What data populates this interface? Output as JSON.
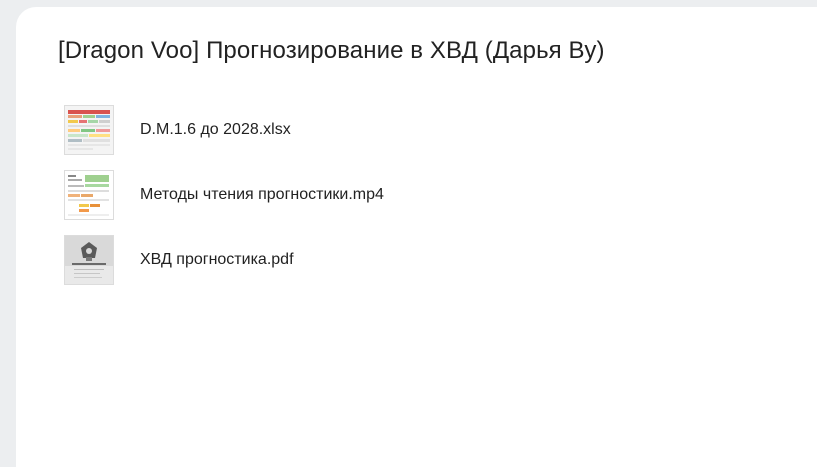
{
  "folder": {
    "title": "[Dragon Voo] Прогнозирование в ХВД (Дарья Ву)"
  },
  "files": [
    {
      "name": "D.M.1.6 до 2028.xlsx",
      "thumb_icon": "spreadsheet-thumbnail-icon"
    },
    {
      "name": "Методы чтения прогностики.mp4",
      "thumb_icon": "video-thumbnail-icon"
    },
    {
      "name": "ХВД прогностика.pdf",
      "thumb_icon": "pdf-thumbnail-icon"
    }
  ],
  "colors": {
    "page_background": "#eceef0",
    "card_background": "#ffffff",
    "text": "#222222"
  }
}
